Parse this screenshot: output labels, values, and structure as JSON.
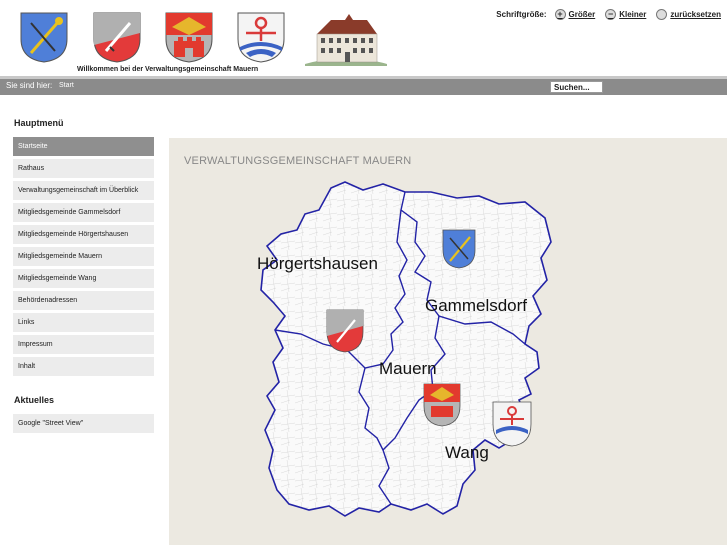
{
  "header": {
    "welcome": "Willkommen bei der Verwaltungsgemeinschaft Mauern",
    "font_size": {
      "label": "Schriftgröße:",
      "bigger": "Größer",
      "smaller": "Kleiner",
      "reset": "zurücksetzen"
    },
    "crests": [
      "crest-gammelsdorf-icon",
      "crest-hoergertshausen-icon",
      "crest-mauern-icon",
      "crest-wang-icon"
    ]
  },
  "breadcrumb": {
    "label": "Sie sind hier:",
    "current": "Start",
    "search_value": "Suchen..."
  },
  "sidebar": {
    "main_heading": "Hauptmenü",
    "items": [
      {
        "label": "Startseite",
        "active": true
      },
      {
        "label": "Rathaus"
      },
      {
        "label": "Verwaltungsgemeinschaft im Überblick"
      },
      {
        "label": "Mitgliedsgemeinde Gammelsdorf"
      },
      {
        "label": "Mitgliedsgemeinde Hörgertshausen"
      },
      {
        "label": "Mitgliedsgemeinde Mauern"
      },
      {
        "label": "Mitgliedsgemeinde Wang"
      },
      {
        "label": "Behördenadressen"
      },
      {
        "label": "Links"
      },
      {
        "label": "Impressum"
      },
      {
        "label": "Inhalt"
      }
    ],
    "news_heading": "Aktuelles",
    "news": [
      {
        "label": "Google \"Street View\""
      }
    ]
  },
  "content": {
    "title": "VERWALTUNGSGEMEINSCHAFT MAUERN",
    "map_labels": {
      "hoergertshausen": "Hörgertshausen",
      "gammelsdorf": "Gammelsdorf",
      "mauern": "Mauern",
      "wang": "Wang"
    }
  },
  "colors": {
    "breadcrumb_bar": "#8b8b8b",
    "active_menu": "#8f8f8f",
    "menu_bg": "#ececec",
    "content_bg": "#ece9e1",
    "border_line": "#2323a6"
  }
}
